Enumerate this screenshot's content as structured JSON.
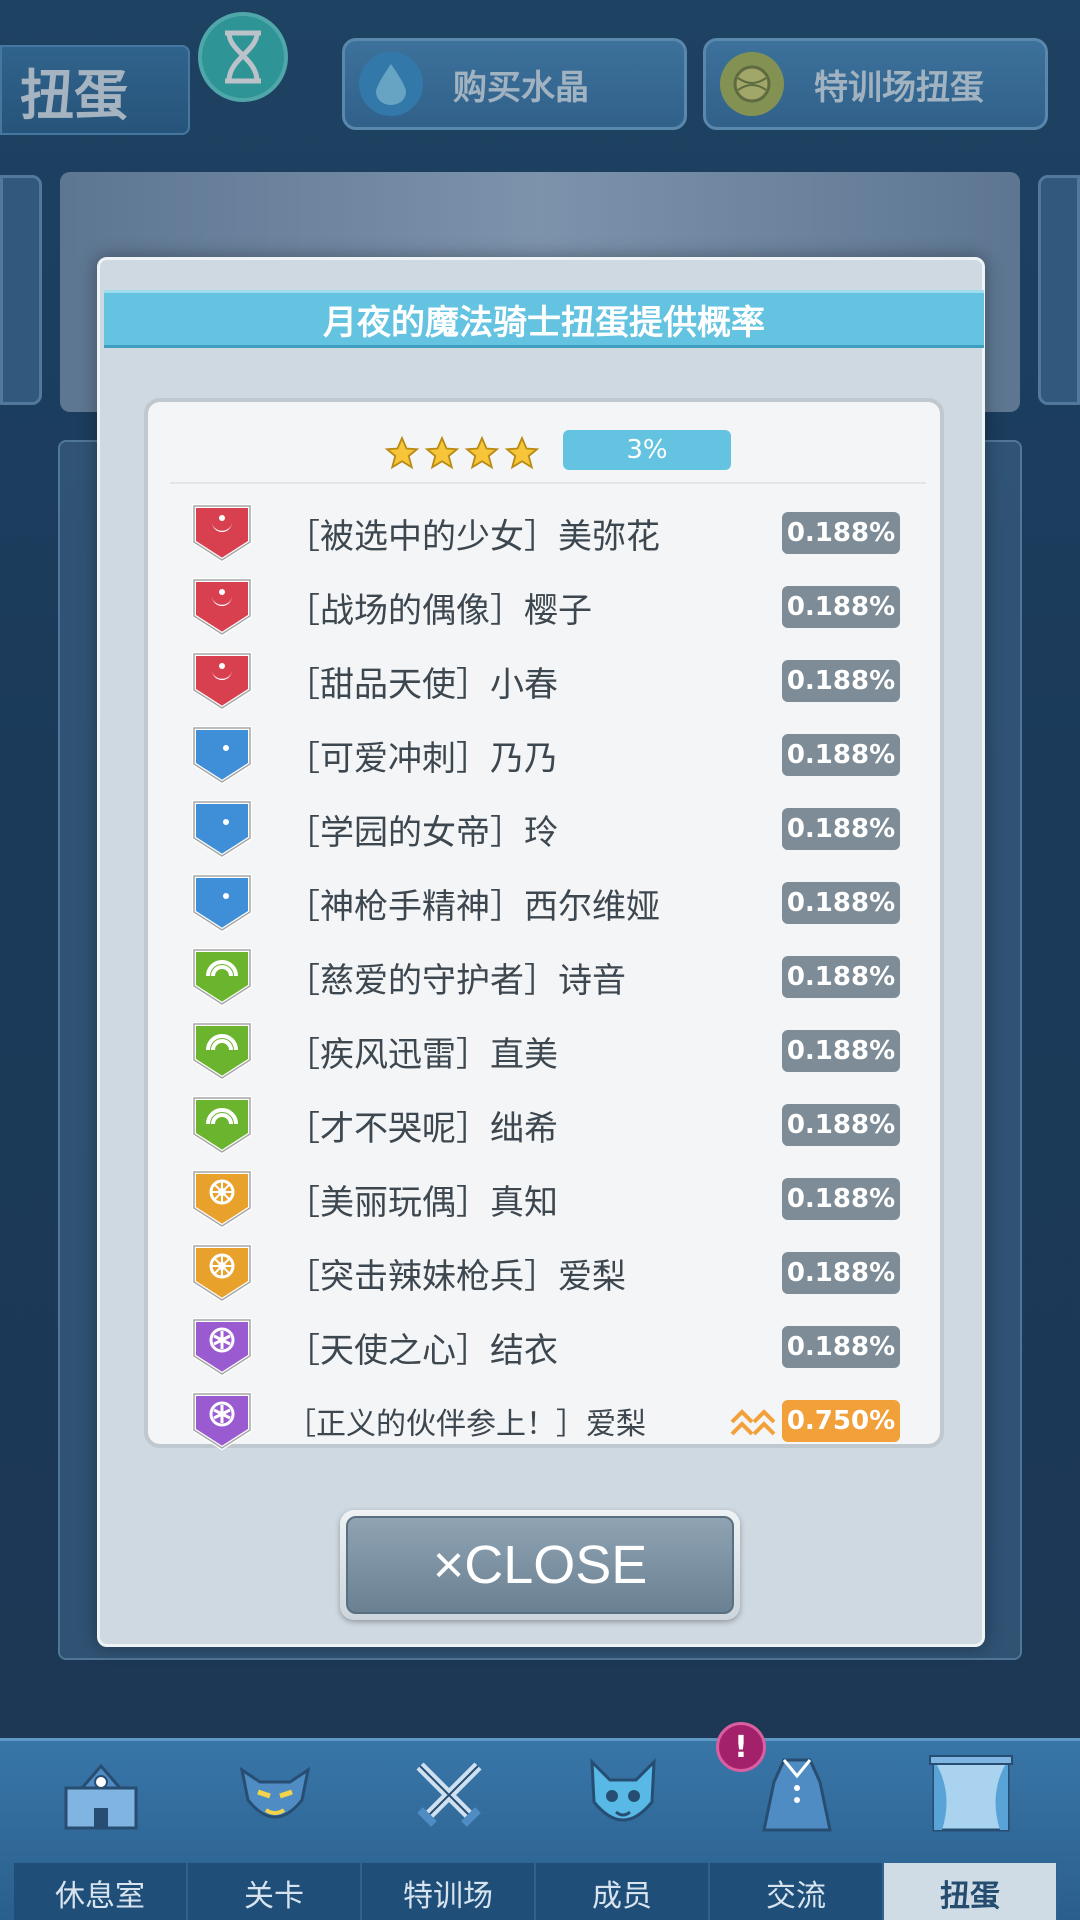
{
  "header": {
    "title": "扭蛋",
    "buy_crystal": "购买水晶",
    "training_gacha": "特训场扭蛋"
  },
  "modal": {
    "title": "月夜的魔法骑士扭蛋提供概率",
    "rarity_stars": 4,
    "rarity_rate": "3%",
    "close_label": "×CLOSE",
    "items": [
      {
        "name": "［被选中的少女］美弥花",
        "rate": "0.188%",
        "type": "red"
      },
      {
        "name": "［战场的偶像］樱子",
        "rate": "0.188%",
        "type": "red"
      },
      {
        "name": "［甜品天使］小春",
        "rate": "0.188%",
        "type": "red"
      },
      {
        "name": "［可爱冲刺］乃乃",
        "rate": "0.188%",
        "type": "blue"
      },
      {
        "name": "［学园的女帝］玲",
        "rate": "0.188%",
        "type": "blue"
      },
      {
        "name": "［神枪手精神］西尔维娅",
        "rate": "0.188%",
        "type": "blue"
      },
      {
        "name": "［慈爱的守护者］诗音",
        "rate": "0.188%",
        "type": "green"
      },
      {
        "name": "［疾风迅雷］直美",
        "rate": "0.188%",
        "type": "green"
      },
      {
        "name": "［才不哭呢］绌希",
        "rate": "0.188%",
        "type": "green"
      },
      {
        "name": "［美丽玩偶］真知",
        "rate": "0.188%",
        "type": "orange"
      },
      {
        "name": "［突击辣妹枪兵］爱梨",
        "rate": "0.188%",
        "type": "orange"
      },
      {
        "name": "［天使之心］结衣",
        "rate": "0.188%",
        "type": "purple"
      },
      {
        "name": "［正义的伙伴参上！］爱梨",
        "rate": "0.750%",
        "type": "purple",
        "rate_up": true
      }
    ]
  },
  "colors": {
    "red": "#d9404f",
    "blue": "#3f8fd8",
    "green": "#6bb52e",
    "orange": "#e8a12b",
    "purple": "#9a5bd0"
  },
  "nav": {
    "items": [
      {
        "label": "休息室",
        "icon": "school-icon"
      },
      {
        "label": "关卡",
        "icon": "demon-icon"
      },
      {
        "label": "特训场",
        "icon": "crossed-swords-icon"
      },
      {
        "label": "成员",
        "icon": "cat-member-icon"
      },
      {
        "label": "交流",
        "icon": "dress-icon"
      },
      {
        "label": "扭蛋",
        "icon": "curtain-icon"
      }
    ],
    "notify_badge": "!"
  }
}
